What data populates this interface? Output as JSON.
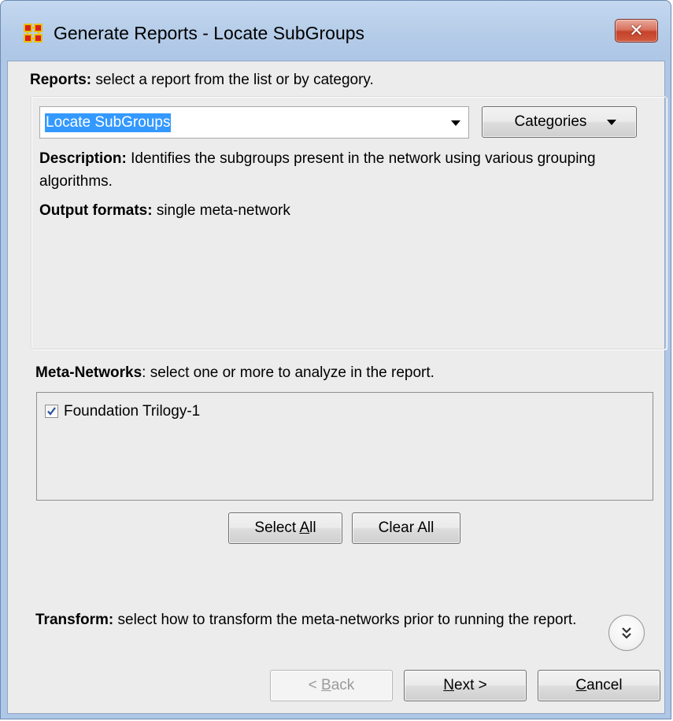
{
  "window": {
    "title": "Generate Reports - Locate SubGroups",
    "close_label": "✕"
  },
  "reports": {
    "heading_bold": "Reports:",
    "heading_rest": " select a report from the list or by category.",
    "selected_report": "Locate SubGroups",
    "categories_label": "Categories",
    "description_bold": "Description:",
    "description_text": " Identifies the subgroups present in the network using various grouping algorithms.",
    "output_bold": "Output formats:",
    "output_text": " single meta-network"
  },
  "meta_networks": {
    "heading_bold": "Meta-Networks",
    "heading_rest": ": select one or more to analyze in the report.",
    "items": [
      {
        "label": "Foundation Trilogy-1",
        "checked": true
      }
    ],
    "select_all_pre": "Select ",
    "select_all_mnemonic": "A",
    "select_all_post": "ll",
    "clear_all_label": "Clear All"
  },
  "transform": {
    "heading_bold": "Transform:",
    "heading_rest": " select how to transform the meta-networks prior to running the report.",
    "expand_icon": "double-chevron-down-icon"
  },
  "footer": {
    "back_pre": "< ",
    "back_mnemonic": "B",
    "back_post": "ack",
    "next_mnemonic": "N",
    "next_post": "ext >",
    "cancel_mnemonic": "C",
    "cancel_post": "ancel"
  },
  "colors": {
    "selection": "#3399ff",
    "client_bg": "#ececec",
    "title_gradient": "#b6cde9",
    "close_red": "#c4432a"
  }
}
